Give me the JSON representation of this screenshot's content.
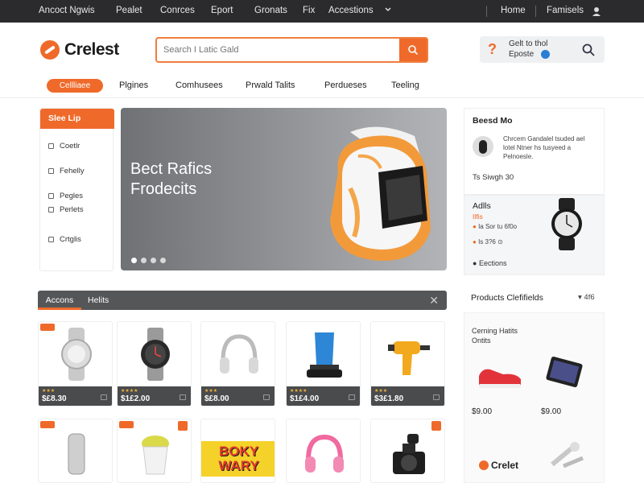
{
  "topbar": {
    "items": [
      "Ancoct Ngwis",
      "Pealet",
      "Conrces",
      "Eport",
      "Gronats",
      "Fix",
      "Accestions"
    ],
    "right": [
      "Home",
      "Famisels"
    ]
  },
  "brand": {
    "name": "Crelest"
  },
  "search": {
    "placeholder": "Search I Latic Gald"
  },
  "help": {
    "line1": "Gelt to thol",
    "line2": "Eposte"
  },
  "categories": {
    "active": "Cellliaee",
    "items": [
      "Plgines",
      "Comhusees",
      "Prwald Talits",
      "Perdueses",
      "Teeling"
    ]
  },
  "sidebar": {
    "header": "Slee Lip",
    "items": [
      "Coetlr",
      "Fehelly",
      "Pegles",
      "Perlets",
      "Crtglis"
    ]
  },
  "hero": {
    "line1": "Bect Rafics",
    "line2": "Frodecits"
  },
  "right_panel": {
    "title": "Beesd Mo",
    "review_text": [
      "Chrcem Gandalel tsuded ael",
      "lotel Ntner hs tusyeed a",
      "Pelnoesle."
    ],
    "meta": "Ts Siwgh 30",
    "deal_title": "Adlls",
    "deal_sub": "Ilfis",
    "deal_price1": "Ia Sor tu 6f0o",
    "deal_price2": "Is 3?6 ⊙",
    "footer": "Eections"
  },
  "products_bar": {
    "tab_active": "Accons",
    "tab2": "Helits"
  },
  "products": [
    {
      "icon": "silver-watch",
      "price": "$£8.30",
      "stars": "★★★"
    },
    {
      "icon": "steel-watch",
      "price": "$1£2.00",
      "stars": "★★★★"
    },
    {
      "icon": "headphones",
      "price": "$£8.00",
      "stars": "★★★"
    },
    {
      "icon": "blue-speaker",
      "price": "$1£4.00",
      "stars": "★★★★"
    },
    {
      "icon": "drill",
      "price": "$3£1.80",
      "stars": "★★★"
    }
  ],
  "products_row2": [
    {
      "icon": "chain-bracelet"
    },
    {
      "icon": "food-jar"
    },
    {
      "icon": "toy-box",
      "label": "BOKY WARY"
    },
    {
      "icon": "pink-headphones"
    },
    {
      "icon": "camera"
    }
  ],
  "right_lower": {
    "title": "Products Clefifields",
    "count": "▾ 4f6",
    "box_title": "Cerning Hatits",
    "box_sub": "Ontits",
    "item1_price": "$9.00",
    "item2_price": "$9.00",
    "brand": "Crelet"
  },
  "colors": {
    "accent": "#ef6a2a",
    "topbar": "#2b2b2d"
  }
}
